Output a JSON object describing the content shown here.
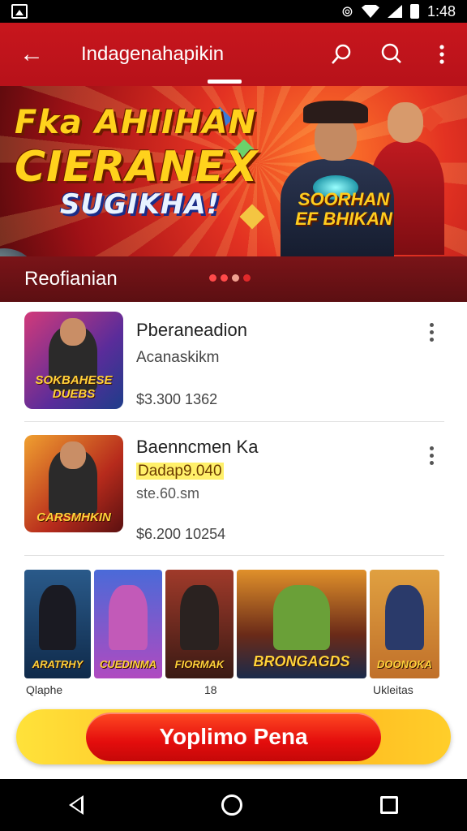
{
  "status_bar": {
    "time": "1:48"
  },
  "app_bar": {
    "title": "Indagenahapikin"
  },
  "banner": {
    "line1": "Fka AHIIHAN",
    "line2": "CIERANEX",
    "line3": "SUGIKHA!",
    "subtitle": "SOORHAN EF BHIKAN"
  },
  "section": {
    "title": "Reofianian"
  },
  "list": {
    "items": [
      {
        "name": "Pberaneadion",
        "subtitle": "Acanaskikm",
        "price": "$3.300  1362",
        "thumb_label": "SOKBAHESE DUEBS"
      },
      {
        "name": "Baenncmen Ka",
        "highlight": "Dadap9.040",
        "subtitle2": "ste.60.sm",
        "price": "$6.200  10254",
        "thumb_label": "CARSMHKIN"
      }
    ]
  },
  "tiles": [
    {
      "label": "ARATRHY"
    },
    {
      "label": "CUEDINMA"
    },
    {
      "label": "FIORMAK"
    },
    {
      "label": "BRONGAGDS"
    },
    {
      "label": "DOONOKA"
    }
  ],
  "tile_captions": [
    "Qlaphe",
    "18",
    "Ukleitas"
  ],
  "cta": {
    "label": "Yoplimo Pena"
  },
  "colors": {
    "brand_red": "#c8161d",
    "cta_red": "#e40d0d",
    "cta_yellow": "#ffce2a"
  }
}
